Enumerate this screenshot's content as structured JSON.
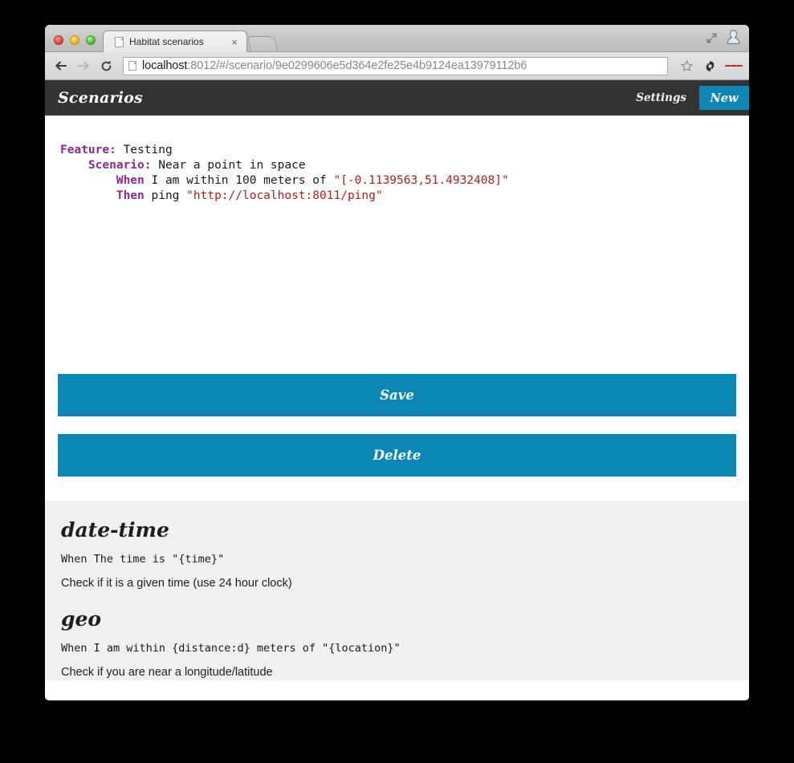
{
  "browser": {
    "tab": {
      "title": "Habitat scenarios",
      "close_label": "×",
      "page_icon": "page-icon"
    },
    "new_tab_label": "",
    "window_controls": [
      "close",
      "minimize",
      "maximize"
    ],
    "toolbar": {
      "back_icon": "back-arrow-icon",
      "forward_icon": "forward-arrow-icon",
      "reload_icon": "reload-icon",
      "url_host": "localhost",
      "url_path": ":8012/#/scenario/9e0299606e5d364e2fe25e4b9124ea13979112b6",
      "url_full": "localhost:8012/#/scenario/9e0299606e5d364e2fe25e4b9124ea13979112b6",
      "star_icon": "star-icon",
      "gear_icon": "gear-icon",
      "menu_icon": "hamburger-menu-icon"
    },
    "tabstrip_right": {
      "expand_icon": "fullscreen-expand-icon",
      "avatar_icon": "user-avatar-icon"
    }
  },
  "app": {
    "brand": "Scenarios",
    "nav": {
      "settings": "Settings",
      "new": "New"
    },
    "accent_color": "#0c86b5",
    "header_color": "#333333",
    "editor": {
      "lines": [
        {
          "indent": 0,
          "parts": [
            {
              "text": "Feature:",
              "type": "keyword"
            },
            {
              "text": " Testing",
              "type": "plain"
            }
          ]
        },
        {
          "indent": 1,
          "parts": [
            {
              "text": "Scenario:",
              "type": "keyword"
            },
            {
              "text": " Near a point in space",
              "type": "plain"
            }
          ]
        },
        {
          "indent": 2,
          "parts": [
            {
              "text": "When",
              "type": "keyword"
            },
            {
              "text": " I am within 100 meters of ",
              "type": "plain"
            },
            {
              "text": "\"[-0.1139563,51.4932408]\"",
              "type": "string"
            }
          ]
        },
        {
          "indent": 2,
          "parts": [
            {
              "text": "Then",
              "type": "keyword"
            },
            {
              "text": " ping ",
              "type": "plain"
            },
            {
              "text": "\"http://localhost:8011/ping\"",
              "type": "string"
            }
          ]
        }
      ],
      "raw": "Feature: Testing\n    Scenario: Near a point in space\n        When I am within 100 meters of \"[-0.1139563,51.4932408]\"\n        Then ping \"http://localhost:8011/ping\"",
      "keyword_color": "#8c2a8c",
      "string_color": "#a82020"
    },
    "buttons": {
      "save": "Save",
      "delete": "Delete"
    },
    "reference": [
      {
        "name": "date-time",
        "pattern": "When The time is \"{time}\"",
        "description": "Check if it is a given time (use 24 hour clock)"
      },
      {
        "name": "geo",
        "pattern": "When I am within {distance:d} meters of \"{location}\"",
        "description": "Check if you are near a longitude/latitude"
      }
    ]
  }
}
